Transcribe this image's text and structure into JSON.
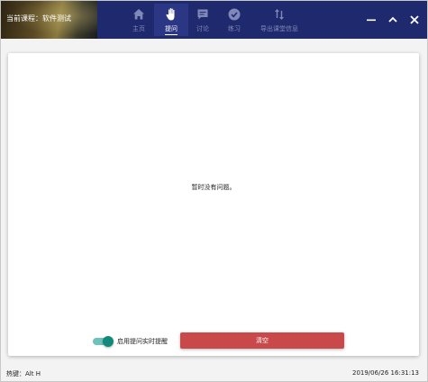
{
  "header": {
    "course_title": "当前课程：软件测试",
    "tabs": [
      {
        "label": "主页",
        "icon": "home-icon",
        "active": false
      },
      {
        "label": "提问",
        "icon": "raised-hand-icon",
        "active": true
      },
      {
        "label": "讨论",
        "icon": "chat-icon",
        "active": false
      },
      {
        "label": "练习",
        "icon": "check-circle-icon",
        "active": false
      },
      {
        "label": "导出课堂信息",
        "icon": "sort-arrows-icon",
        "active": false
      }
    ],
    "window_controls": [
      "minimize-icon",
      "maximize-icon",
      "close-icon"
    ]
  },
  "main": {
    "empty_message": "暂时没有问题。",
    "toggle": {
      "label": "启用提问实时提醒",
      "on": true
    },
    "clear_button": "清空"
  },
  "status_bar": {
    "hotkey": "热键：Alt H",
    "datetime": "2019/06/26 16:31:13"
  },
  "colors": {
    "header_bg": "#1f2a6e",
    "active_tab_bg": "#2b3784",
    "inactive_label": "#7f88b8",
    "toggle_on": "#13897c",
    "clear_button": "#c9494b"
  }
}
